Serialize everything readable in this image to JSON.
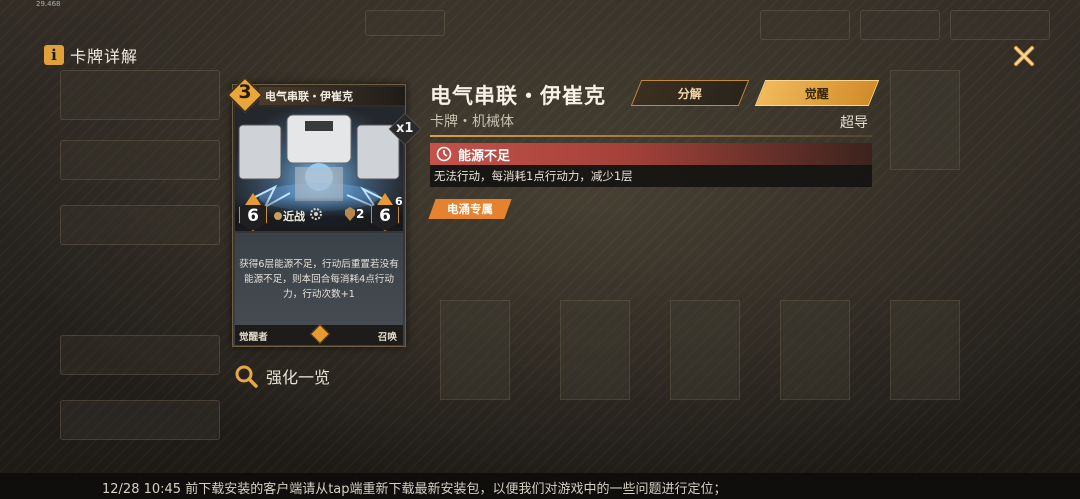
{
  "debug_value": "29.468",
  "header": {
    "title": "卡牌详解"
  },
  "card": {
    "cost": "3",
    "name": "电气串联・伊崔克",
    "count": "x1",
    "attack": "6",
    "attack_type": "近战",
    "small_stat": "2",
    "defense": "6",
    "corner_stat": "6",
    "description": "获得6层能源不足，行动后重置若没有能源不足，则本回合每消耗4点行动力，行动次数+1",
    "footer_left": "觉醒者",
    "footer_right": "召唤"
  },
  "enhance": {
    "label": "强化一览"
  },
  "detail": {
    "title": "电气串联・伊崔克",
    "subtitle": "卡牌・机械体",
    "tag_right": "超导",
    "decompose_label": "分解",
    "awaken_label": "觉醒",
    "status_name": "能源不足",
    "status_description": "无法行动，每消耗1点行动力，减少1层",
    "exclusive_tag": "电涌专属"
  },
  "notice": {
    "text": "12/28 10:45 前下载安装的客户端请从tap端重新下载最新安装包，以便我们对游戏中的一些问题进行定位；"
  },
  "colors": {
    "accent": "#e0a13a",
    "status_red": "#c3524a",
    "tag_orange": "#e4822f"
  }
}
